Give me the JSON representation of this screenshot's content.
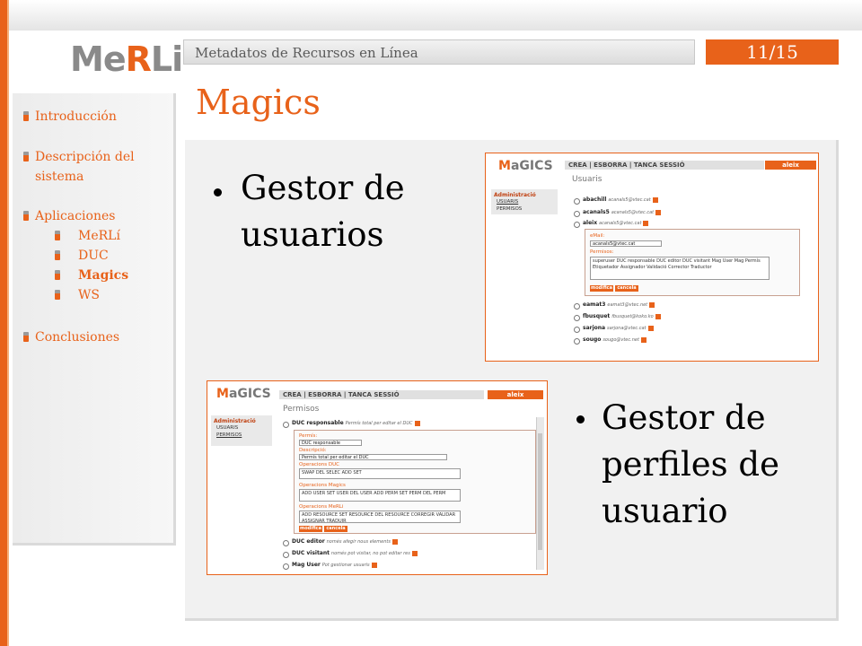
{
  "header": {
    "logo_prefix": "Me",
    "logo_r": "R",
    "logo_suffix": "Li",
    "banner": "Metadatos de Recursos en Línea",
    "page": "11/15"
  },
  "sidebar": {
    "items": [
      {
        "label": "Introducción"
      },
      {
        "label": "Descripción del"
      },
      {
        "label": "sistema"
      },
      {
        "label": "Aplicaciones"
      },
      {
        "label": "MeRLí"
      },
      {
        "label": "DUC"
      },
      {
        "label": "Magics"
      },
      {
        "label": "WS"
      },
      {
        "label": "Conclusiones"
      }
    ]
  },
  "main": {
    "title": "Magics",
    "bullet1": [
      "Gestor de",
      "usuarios"
    ],
    "bullet2": [
      "Gestor de",
      "perfiles de",
      "usuario"
    ]
  },
  "shot1": {
    "logo": "MaGICS",
    "menu": "CREA | ESBORRA | TANCA SESSIÓ",
    "user": "aleix",
    "section": "Usuaris",
    "side_title": "Administració",
    "side_items": [
      "USUARIS",
      "PERMISOS"
    ],
    "users": [
      {
        "name": "abachill",
        "email": "acanals5@vtec.cat"
      },
      {
        "name": "acanals5",
        "email": "acanals5@vtec.cat"
      },
      {
        "name": "aleix",
        "email": "acanals5@vtec.cat"
      }
    ],
    "email_label": "eMail:",
    "email_value": "acanals5@vtec.cat",
    "perm_label": "Permisos:",
    "perm_text": "superuser  DUC responsable  DUC editor  DUC visitant  Mag User  Mag Permís  Etiquetador  Assignador  Validació  Corrector  Traductor",
    "btn_modify": "modifica",
    "btn_cancel": "cancela",
    "users2": [
      {
        "name": "eamat3",
        "email": "eamat3@vtec.net"
      },
      {
        "name": "fbusquet",
        "email": "fbusquet@koko.ko"
      },
      {
        "name": "sarjona",
        "email": "sarjona@vtec.cat"
      },
      {
        "name": "sougo",
        "email": "sougo@vtec.net"
      }
    ]
  },
  "shot2": {
    "logo": "MaGICS",
    "menu": "CREA | ESBORRA | TANCA SESSIÓ",
    "user": "aleix",
    "section": "Permisos",
    "side_title": "Administració",
    "side_items": [
      "USUARIS",
      "PERMISOS"
    ],
    "first_role": "DUC responsable",
    "first_desc": "Permís total per editar el DUC",
    "lbl_perm": "Permís:",
    "perm_value": "DUC responsable",
    "lbl_desc": "Descripció:",
    "desc_value": "Permís total per editar el DUC",
    "ops_duc": "Operacions DUC",
    "ops_duc_items": "SWAP  DEL  SELEC  ADD  SET",
    "ops_magics": "Operacions Magics",
    "ops_magics_items": "ADD USER  SET USER  DEL USER  ADD PERM  SET PERM  DEL PERM",
    "ops_merli": "Operacions MeRLi",
    "ops_merli_items": "ADD RESOURCE  SET RESOURCE  DEL RESOURCE  CORREGIR  VALIDAR  ASSIGNAR  TRADUIR",
    "btn_modify": "modifica",
    "btn_cancel": "cancela",
    "roles2": [
      {
        "name": "DUC editor",
        "desc": "només afegir nous elements"
      },
      {
        "name": "DUC visitant",
        "desc": "només pot visitar, no pot editar res"
      },
      {
        "name": "Mag User",
        "desc": "Pot gestionar usuaris"
      }
    ]
  }
}
